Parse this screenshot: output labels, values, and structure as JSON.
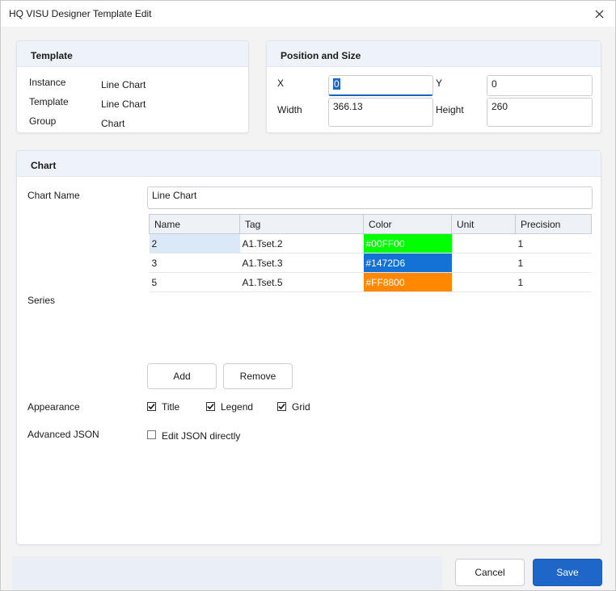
{
  "window": {
    "title": "HQ VISU Designer Template Edit"
  },
  "template_panel": {
    "title": "Template",
    "rows": [
      {
        "label": "Instance",
        "value": "Line Chart"
      },
      {
        "label": "Template",
        "value": "Line Chart"
      },
      {
        "label": "Group",
        "value": "Chart"
      }
    ]
  },
  "position_panel": {
    "title": "Position and Size",
    "x_label": "X",
    "x_value": "0",
    "y_label": "Y",
    "y_value": "0",
    "width_label": "Width",
    "width_value": "366.13",
    "height_label": "Height",
    "height_value": "260"
  },
  "chart_panel": {
    "title": "Chart",
    "chart_name_label": "Chart Name",
    "chart_name_value": "Line Chart",
    "series_label": "Series",
    "columns": [
      "Name",
      "Tag",
      "Color",
      "Unit",
      "Precision"
    ],
    "rows": [
      {
        "name": "2",
        "tag": "A1.Tset.2",
        "color": "#00FF00",
        "unit": "",
        "precision": "1"
      },
      {
        "name": "3",
        "tag": "A1.Tset.3",
        "color": "#1472D6",
        "unit": "",
        "precision": "1"
      },
      {
        "name": "5",
        "tag": "A1.Tset.5",
        "color": "#FF8800",
        "unit": "",
        "precision": "1"
      }
    ],
    "add_label": "Add",
    "remove_label": "Remove",
    "appearance_label": "Appearance",
    "title_check": "Title",
    "legend_check": "Legend",
    "grid_check": "Grid",
    "advanced_label": "Advanced JSON",
    "edit_json_check": "Edit JSON directly"
  },
  "footer": {
    "cancel_label": "Cancel",
    "save_label": "Save"
  },
  "colors": {
    "accent": "#1f66c9",
    "selected_row": "#dbe8f8"
  }
}
